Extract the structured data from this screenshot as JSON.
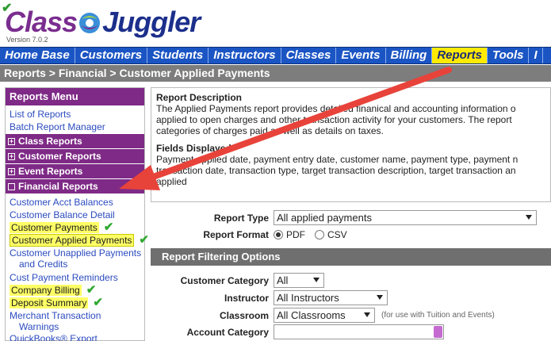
{
  "app": {
    "logo_class": "Class",
    "logo_juggler": "Juggler",
    "version": "Version 7.0.2"
  },
  "nav": {
    "items": [
      "Home Base",
      "Customers",
      "Students",
      "Instructors",
      "Classes",
      "Events",
      "Billing",
      "Reports",
      "Tools",
      "I"
    ],
    "active": "Reports"
  },
  "breadcrumb": "Reports > Financial > Customer Applied Payments",
  "menu": {
    "title": "Reports Menu",
    "top_links": [
      "List of Reports",
      "Batch Report Manager"
    ],
    "sections": {
      "class": "Class Reports",
      "customer": "Customer Reports",
      "event": "Event Reports",
      "financial": "Financial Reports"
    },
    "financial_items": {
      "acct_balances": "Customer Acct Balances",
      "balance_detail": "Customer Balance Detail",
      "payments": "Customer Payments",
      "applied_payments": "Customer Applied Payments",
      "unapplied_1": "Customer Unapplied Payments",
      "unapplied_2": "and Credits",
      "reminders": "Cust Payment Reminders",
      "company_billing": "Company Billing",
      "deposit_summary": "Deposit Summary",
      "merchant_1": "Merchant Transaction",
      "merchant_2": "Warnings",
      "quickbooks": "QuickBooks® Export"
    }
  },
  "description": {
    "heading": "Report Description",
    "lines": [
      "The Applied Payments report provides detailed finanical and accounting information o",
      "applied to open charges and other transaction activity for your customers. The report",
      "categories of charges paid as well as details on taxes."
    ],
    "fields_heading": "Fields Displayed",
    "fields_lines": [
      "Payment applied date, payment entry date, customer name, payment type, payment n",
      "transaction date, transaction type, target transaction description, target transaction an",
      "applied"
    ]
  },
  "form": {
    "report_type_label": "Report Type",
    "report_type_value": "All applied payments",
    "report_format_label": "Report Format",
    "format_pdf": "PDF",
    "format_csv": "CSV",
    "filter_heading": "Report Filtering Options",
    "customer_category_label": "Customer Category",
    "customer_category_value": "All",
    "instructor_label": "Instructor",
    "instructor_value": "All Instructors",
    "classroom_label": "Classroom",
    "classroom_value": "All Classrooms",
    "classroom_hint": "(for use with Tuition and Events)",
    "account_category_label": "Account Category",
    "account_category_value": ""
  },
  "colors": {
    "nav_bg": "#1b55c4",
    "nav_active": "#ffea00",
    "menu_header": "#7e2a86",
    "highlight": "#ffff66",
    "check": "#2fa82f",
    "arrow": "#e8433a"
  }
}
